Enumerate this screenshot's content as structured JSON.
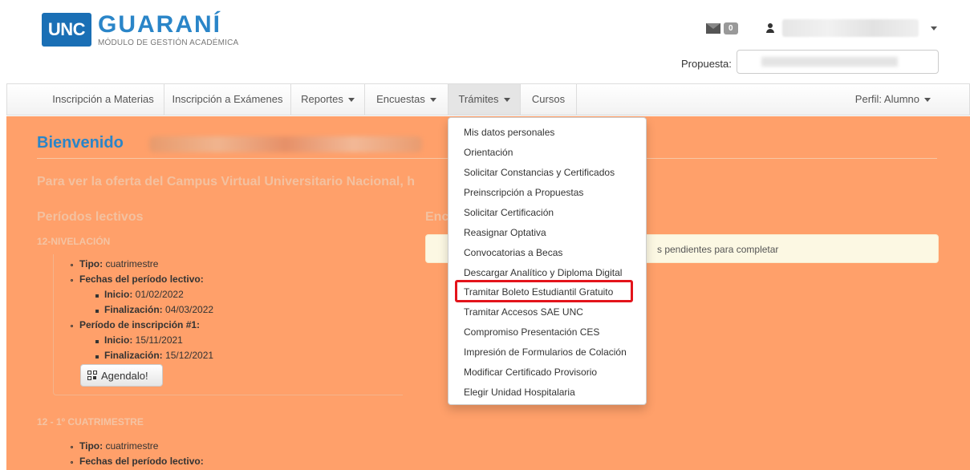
{
  "header": {
    "logo_box": "UNC",
    "logo_title": "GUARANÍ",
    "logo_subtitle": "MÓDULO DE GESTIÓN ACADÉMICA",
    "messages_count": "0",
    "propuesta_label": "Propuesta:"
  },
  "nav": {
    "items": [
      {
        "label": "Inscripción a Materias"
      },
      {
        "label": "Inscripción a Exámenes"
      },
      {
        "label": "Reportes"
      },
      {
        "label": "Encuestas"
      },
      {
        "label": "Trámites"
      },
      {
        "label": "Cursos"
      }
    ],
    "perfil": "Perfil: Alumno"
  },
  "main": {
    "welcome": "Bienvenido",
    "campus_text": "Para ver la oferta del Campus Virtual Universitario Nacional, h",
    "periodos_title": "Períodos lectivos",
    "encuestas_title": "Enc",
    "alert_text": "s pendientes para completar",
    "section1": {
      "title": "12-NIVELACIÓN",
      "tipo_label": "Tipo:",
      "tipo_value": " cuatrimestre",
      "fechas_label": "Fechas del período lectivo:",
      "inicio_label": "Inicio:",
      "inicio_value": " 01/02/2022",
      "fin_label": "Finalización:",
      "fin_value": " 04/03/2022",
      "inscripcion_label": "Período de inscripción #1:",
      "insc_inicio_label": "Inicio:",
      "insc_inicio_value": " 15/11/2021",
      "insc_fin_label": "Finalización:",
      "insc_fin_value": " 15/12/2021",
      "agendalo": "Agendalo!"
    },
    "section2": {
      "title": "12 - 1º CUATRIMESTRE",
      "tipo_label": "Tipo:",
      "tipo_value": " cuatrimestre",
      "fechas_label": "Fechas del período lectivo:"
    }
  },
  "dropdown": {
    "items": [
      "Mis datos personales",
      "Orientación",
      "Solicitar Constancias y Certificados",
      "Preinscripción a Propuestas",
      "Solicitar Certificación",
      "Reasignar Optativa",
      "Convocatorias a Becas",
      "Descargar Analítico y Diploma Digital",
      "Tramitar Boleto Estudiantil Gratuito",
      "Tramitar Accesos SAE UNC",
      "Compromiso Presentación CES",
      "Impresión de Formularios de Colación",
      "Modificar Certificado Provisorio",
      "Elegir Unidad Hospitalaria"
    ]
  },
  "colors": {
    "main_bg": "#ffa06a",
    "brand_blue": "#2a85c8",
    "highlight": "#e3141b"
  }
}
